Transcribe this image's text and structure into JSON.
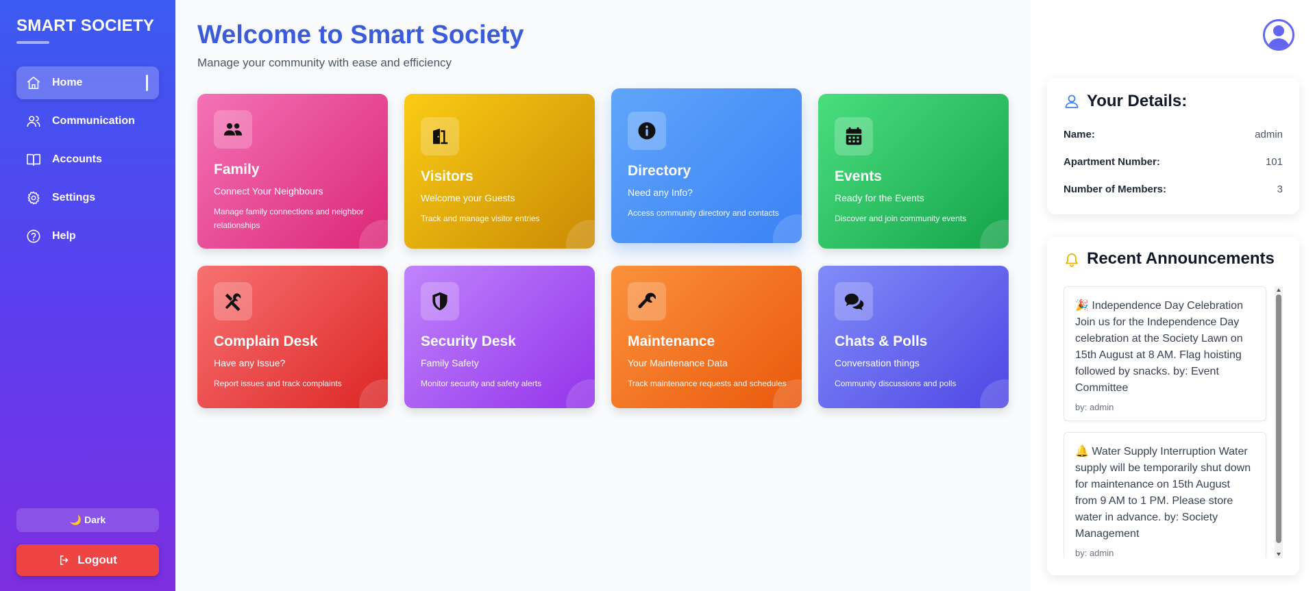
{
  "sidebar": {
    "brand": "SMART SOCIETY",
    "items": [
      {
        "label": "Home",
        "icon": "home-icon",
        "active": true
      },
      {
        "label": "Communication",
        "icon": "users-icon",
        "active": false
      },
      {
        "label": "Accounts",
        "icon": "book-icon",
        "active": false
      },
      {
        "label": "Settings",
        "icon": "gear-icon",
        "active": false
      },
      {
        "label": "Help",
        "icon": "help-circle-icon",
        "active": false
      }
    ],
    "theme_label": "🌙 Dark",
    "logout_label": "Logout"
  },
  "main": {
    "title": "Welcome to Smart Society",
    "subtitle": "Manage your community with ease and efficiency",
    "cards": [
      {
        "title": "Family",
        "subtitle": "Connect Your Neighbours",
        "description": "Manage family connections and neighbor relationships",
        "icon": "users-icon",
        "color_from": "#f472b6",
        "color_to": "#db2777"
      },
      {
        "title": "Visitors",
        "subtitle": "Welcome your Guests",
        "description": "Track and manage visitor entries",
        "icon": "door-open-icon",
        "color_from": "#facc15",
        "color_to": "#ca8a04"
      },
      {
        "title": "Directory",
        "subtitle": "Need any Info?",
        "description": "Access community directory and contacts",
        "icon": "info-icon",
        "color_from": "#60a5fa",
        "color_to": "#3b82f6"
      },
      {
        "title": "Events",
        "subtitle": "Ready for the Events",
        "description": "Discover and join community events",
        "icon": "calendar-icon",
        "color_from": "#4ade80",
        "color_to": "#16a34a"
      },
      {
        "title": "Complain Desk",
        "subtitle": "Have any Issue?",
        "description": "Report issues and track complaints",
        "icon": "tools-icon",
        "color_from": "#f87171",
        "color_to": "#dc2626"
      },
      {
        "title": "Security Desk",
        "subtitle": "Family Safety",
        "description": "Monitor security and safety alerts",
        "icon": "shield-icon",
        "color_from": "#c084fc",
        "color_to": "#9333ea"
      },
      {
        "title": "Maintenance",
        "subtitle": "Your Maintenance Data",
        "description": "Track maintenance requests and schedules",
        "icon": "wrench-icon",
        "color_from": "#fb923c",
        "color_to": "#ea580c"
      },
      {
        "title": "Chats & Polls",
        "subtitle": "Conversation things",
        "description": "Community discussions and polls",
        "icon": "chat-icon",
        "color_from": "#818cf8",
        "color_to": "#4f46e5"
      }
    ]
  },
  "details": {
    "title": "Your Details:",
    "rows": [
      {
        "label": "Name:",
        "value": "admin"
      },
      {
        "label": "Apartment Number:",
        "value": "101"
      },
      {
        "label": "Number of Members:",
        "value": "3"
      }
    ]
  },
  "announcements": {
    "title": "Recent Announcements",
    "items": [
      {
        "text": "🎉 Independence Day Celebration Join us for the Independence Day celebration at the Society Lawn on 15th August at 8 AM. Flag hoisting followed by snacks. by: Event Committee",
        "by": "by: admin"
      },
      {
        "text": "🔔 Water Supply Interruption Water supply will be temporarily shut down for maintenance on 15th August from 9 AM to 1 PM. Please store water in advance. by: Society Management",
        "by": "by: admin"
      }
    ]
  },
  "colors": {
    "accent": "#3b5bdb",
    "logout": "#ef4444",
    "details_icon": "#3b82f6",
    "announcement_icon": "#eab308"
  }
}
